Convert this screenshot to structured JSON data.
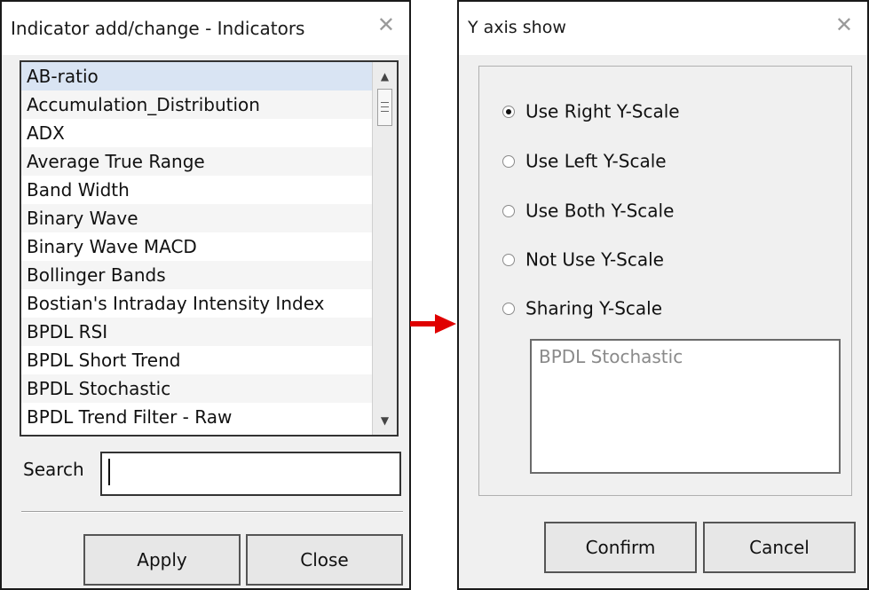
{
  "left_window": {
    "title": "Indicator add/change - Indicators",
    "close_glyph": "✕",
    "list_items": [
      "AB-ratio",
      "Accumulation_Distribution",
      "ADX",
      "Average True Range",
      "Band Width",
      "Binary Wave",
      "Binary Wave MACD",
      "Bollinger Bands",
      "Bostian's Intraday Intensity Index",
      "BPDL RSI",
      "BPDL Short Trend",
      "BPDL Stochastic",
      "BPDL Trend Filter - Raw"
    ],
    "selected_item": "AB-ratio",
    "search_label": "Search",
    "search_value": "",
    "apply_label": "Apply",
    "close_label": "Close"
  },
  "right_window": {
    "title": "Y axis show",
    "close_glyph": "✕",
    "options": [
      {
        "label": "Use Right Y-Scale",
        "checked": true
      },
      {
        "label": "Use Left Y-Scale",
        "checked": false
      },
      {
        "label": "Use Both Y-Scale",
        "checked": false
      },
      {
        "label": "Not Use Y-Scale",
        "checked": false
      },
      {
        "label": "Sharing Y-Scale",
        "checked": false
      }
    ],
    "sharing_list_items": [
      "BPDL Stochastic"
    ],
    "confirm_label": "Confirm",
    "cancel_label": "Cancel"
  },
  "colors": {
    "selection": "#d9e4f3",
    "arrow": "#e00000",
    "window_bg": "#f0f0f0"
  }
}
